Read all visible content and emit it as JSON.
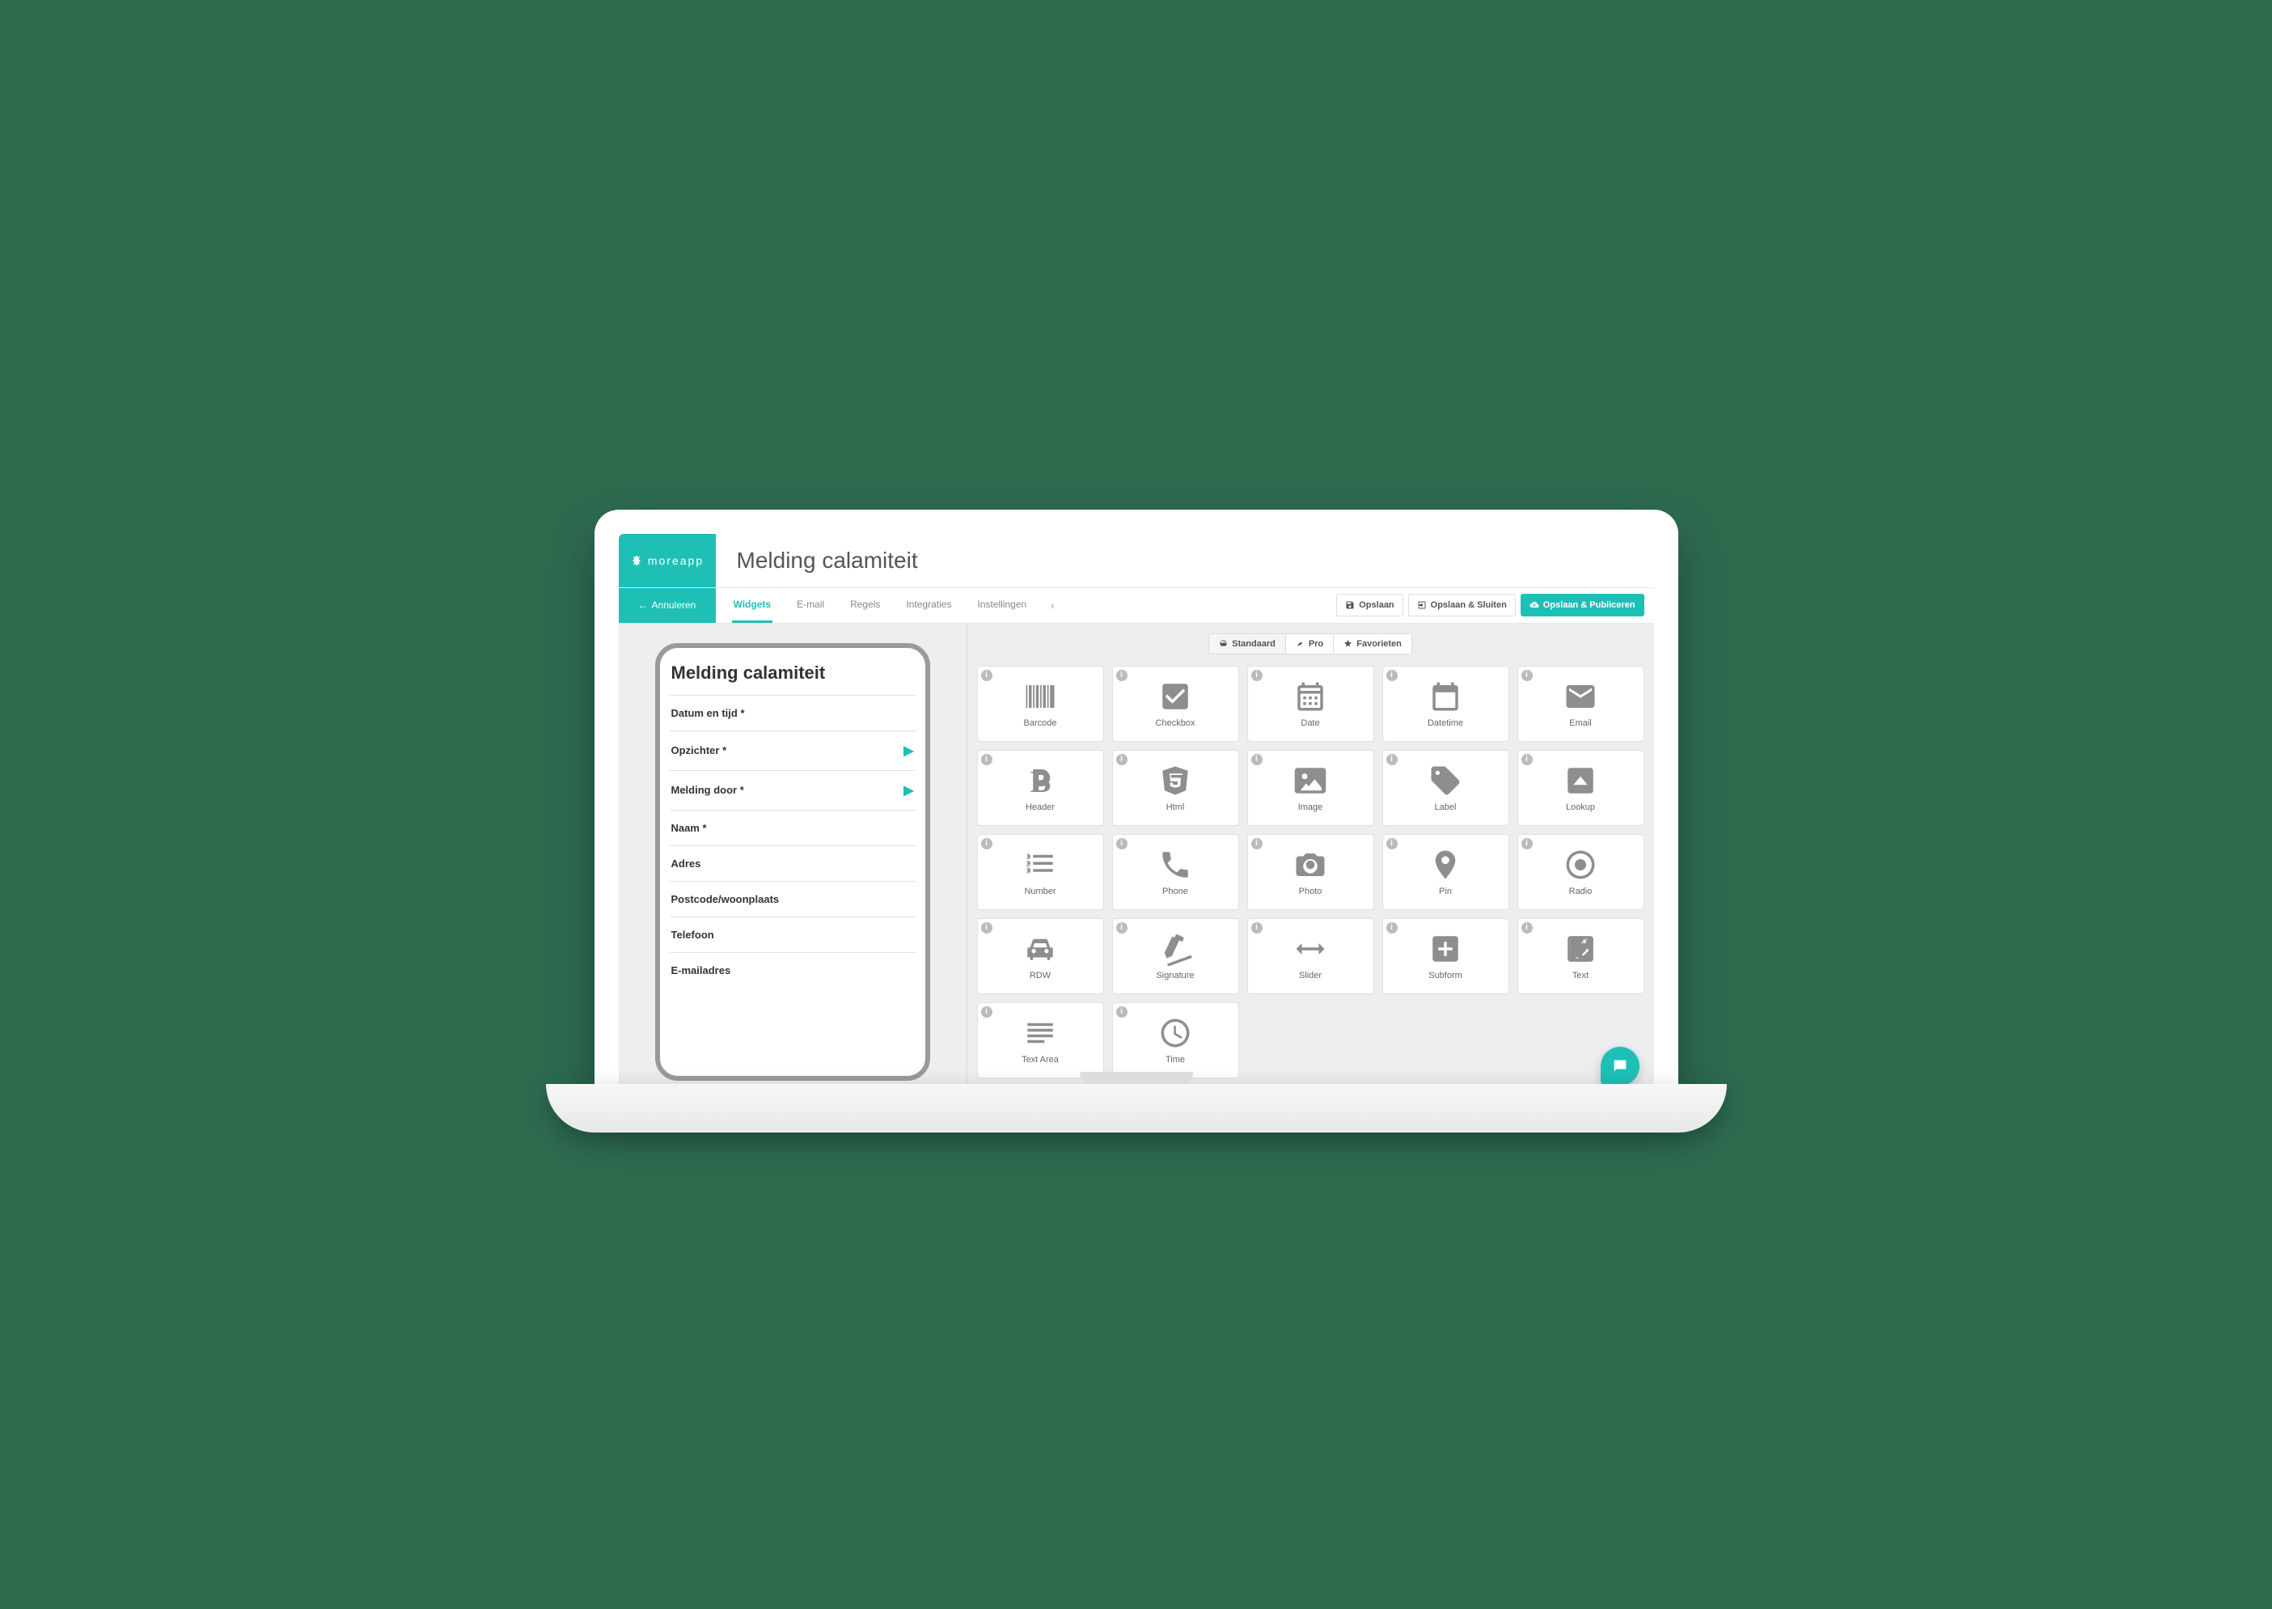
{
  "brand": "moreapp",
  "page_title": "Melding calamiteit",
  "cancel_label": "Annuleren",
  "tabs": {
    "widgets": "Widgets",
    "email": "E-mail",
    "rules": "Regels",
    "integrations": "Integraties",
    "settings": "Instellingen"
  },
  "actions": {
    "save": "Opslaan",
    "save_close": "Opslaan & Sluiten",
    "save_publish": "Opslaan & Publiceren"
  },
  "widget_tabs": {
    "standard": "Standaard",
    "pro": "Pro",
    "favorites": "Favorieten"
  },
  "form": {
    "title": "Melding calamiteit",
    "fields": [
      {
        "label": "Datum en tijd *",
        "chevron": false
      },
      {
        "label": "Opzichter *",
        "chevron": true
      },
      {
        "label": "Melding door *",
        "chevron": true
      },
      {
        "label": "Naam *",
        "chevron": false
      },
      {
        "label": "Adres",
        "chevron": false
      },
      {
        "label": "Postcode/woonplaats",
        "chevron": false
      },
      {
        "label": "Telefoon",
        "chevron": false
      },
      {
        "label": "E-mailadres",
        "chevron": false
      }
    ]
  },
  "widgets": [
    {
      "key": "barcode",
      "label": "Barcode"
    },
    {
      "key": "checkbox",
      "label": "Checkbox"
    },
    {
      "key": "date",
      "label": "Date"
    },
    {
      "key": "datetime",
      "label": "Datetime"
    },
    {
      "key": "email",
      "label": "Email"
    },
    {
      "key": "header",
      "label": "Header"
    },
    {
      "key": "html",
      "label": "Html"
    },
    {
      "key": "image",
      "label": "Image"
    },
    {
      "key": "label",
      "label": "Label"
    },
    {
      "key": "lookup",
      "label": "Lookup"
    },
    {
      "key": "number",
      "label": "Number"
    },
    {
      "key": "phone",
      "label": "Phone"
    },
    {
      "key": "photo",
      "label": "Photo"
    },
    {
      "key": "pin",
      "label": "Pin"
    },
    {
      "key": "radio",
      "label": "Radio"
    },
    {
      "key": "rdw",
      "label": "RDW"
    },
    {
      "key": "signature",
      "label": "Signature"
    },
    {
      "key": "slider",
      "label": "Slider"
    },
    {
      "key": "subform",
      "label": "Subform"
    },
    {
      "key": "text",
      "label": "Text"
    },
    {
      "key": "textarea",
      "label": "Text Area"
    },
    {
      "key": "time",
      "label": "Time"
    }
  ]
}
